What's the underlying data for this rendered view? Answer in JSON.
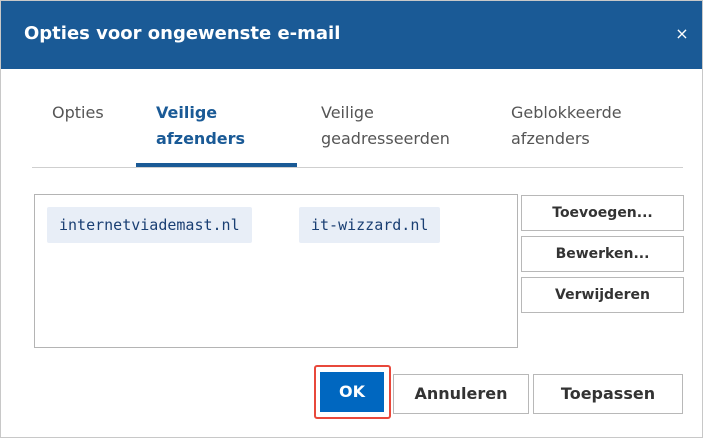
{
  "dialog": {
    "title": "Opties voor ongewenste e-mail",
    "close_label": "×"
  },
  "tabs": [
    {
      "line1": "Opties",
      "line2": ""
    },
    {
      "line1": "Veilige",
      "line2": "afzenders"
    },
    {
      "line1": "Veilige",
      "line2": "geadresseerden"
    },
    {
      "line1": "Geblokkeerde",
      "line2": "afzenders"
    }
  ],
  "active_tab": "Veilige afzenders",
  "safe_senders": [
    "internetviademast.nl",
    "it-wizzard.nl"
  ],
  "side_buttons": {
    "add": "Toevoegen...",
    "edit": "Bewerken...",
    "remove": "Verwijderen"
  },
  "footer": {
    "ok": "OK",
    "cancel": "Annuleren",
    "apply": "Toepassen"
  },
  "colors": {
    "titlebar": "#1a5a96",
    "accent": "#0067c0",
    "chip_bg": "#e8eef7",
    "highlight": "#e8483b"
  }
}
